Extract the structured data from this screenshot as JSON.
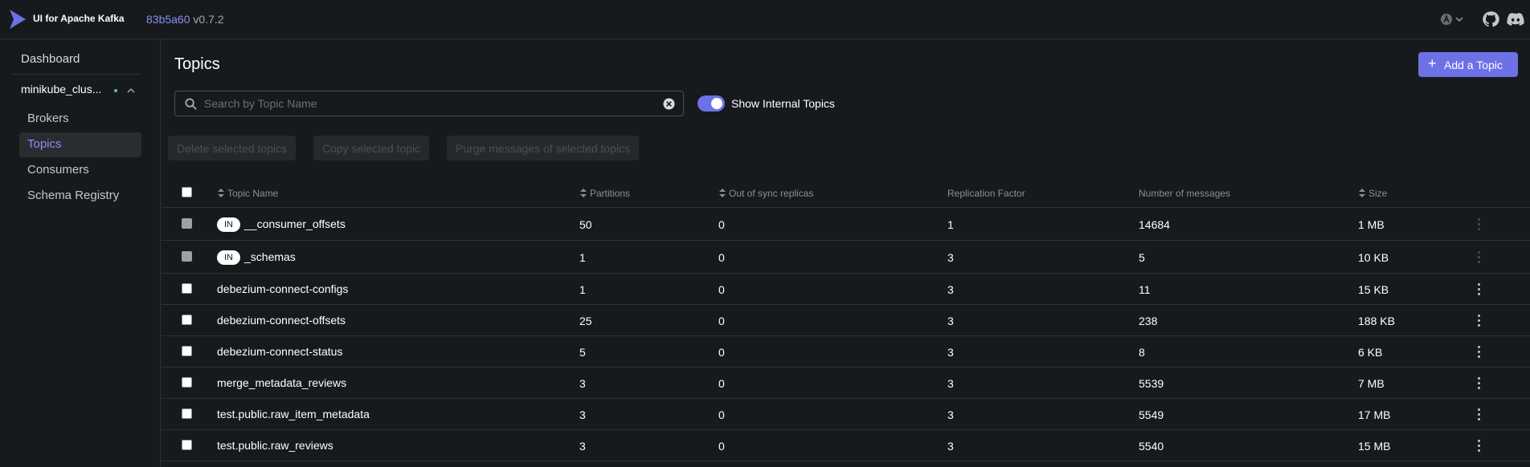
{
  "app": {
    "title": "UI for Apache Kafka",
    "commit_hash": "83b5a60",
    "version": "v0.7.2",
    "accent_color": "#6d71e6",
    "link_color": "#8a8ef7"
  },
  "top_icons": [
    "user-avatar-icon",
    "chevron-down-icon",
    "github-icon",
    "discord-icon"
  ],
  "sidebar": {
    "dashboard": "Dashboard",
    "cluster_name": "minikube_clus...",
    "cluster_status_color": "#5ccc7a",
    "items": [
      {
        "label": "Brokers",
        "active": false
      },
      {
        "label": "Topics",
        "active": true
      },
      {
        "label": "Consumers",
        "active": false
      },
      {
        "label": "Schema Registry",
        "active": false
      }
    ]
  },
  "main": {
    "title": "Topics",
    "add_button": "Add a Topic",
    "search_placeholder": "Search by Topic Name",
    "search_value": "",
    "show_internal_label": "Show Internal Topics",
    "show_internal_enabled": true,
    "bulk_actions": [
      "Delete selected topics",
      "Copy selected topic",
      "Purge messages of selected topics"
    ]
  },
  "table": {
    "columns": [
      {
        "label": "Topic Name",
        "sortable": true
      },
      {
        "label": "Partitions",
        "sortable": true
      },
      {
        "label": "Out of sync replicas",
        "sortable": true
      },
      {
        "label": "Replication Factor",
        "sortable": false
      },
      {
        "label": "Number of messages",
        "sortable": false
      },
      {
        "label": "Size",
        "sortable": true
      }
    ],
    "internal_badge": "IN",
    "rows": [
      {
        "name": "__consumer_offsets",
        "internal": true,
        "partitions": "50",
        "out_of_sync": "0",
        "replication": "1",
        "messages": "14684",
        "size": "1 MB"
      },
      {
        "name": "_schemas",
        "internal": true,
        "partitions": "1",
        "out_of_sync": "0",
        "replication": "3",
        "messages": "5",
        "size": "10 KB"
      },
      {
        "name": "debezium-connect-configs",
        "internal": false,
        "partitions": "1",
        "out_of_sync": "0",
        "replication": "3",
        "messages": "11",
        "size": "15 KB"
      },
      {
        "name": "debezium-connect-offsets",
        "internal": false,
        "partitions": "25",
        "out_of_sync": "0",
        "replication": "3",
        "messages": "238",
        "size": "188 KB"
      },
      {
        "name": "debezium-connect-status",
        "internal": false,
        "partitions": "5",
        "out_of_sync": "0",
        "replication": "3",
        "messages": "8",
        "size": "6 KB"
      },
      {
        "name": "merge_metadata_reviews",
        "internal": false,
        "partitions": "3",
        "out_of_sync": "0",
        "replication": "3",
        "messages": "5539",
        "size": "7 MB"
      },
      {
        "name": "test.public.raw_item_metadata",
        "internal": false,
        "partitions": "3",
        "out_of_sync": "0",
        "replication": "3",
        "messages": "5549",
        "size": "17 MB"
      },
      {
        "name": "test.public.raw_reviews",
        "internal": false,
        "partitions": "3",
        "out_of_sync": "0",
        "replication": "3",
        "messages": "5540",
        "size": "15 MB"
      }
    ]
  }
}
